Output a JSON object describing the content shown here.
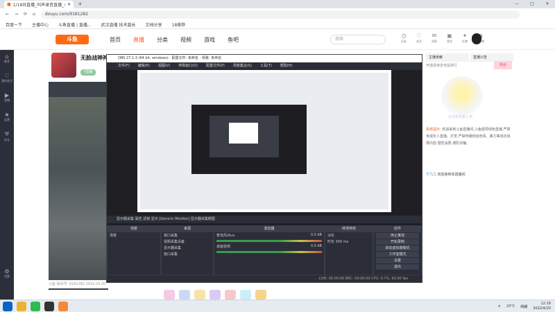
{
  "browser": {
    "tab_title": "1/18共直播_叫声录音直播_斗鱼",
    "close_glyph": "✕",
    "new_tab": "+",
    "url": "douyu.com/9181282",
    "bookmarks": [
      "百度一下",
      "主播中心",
      "斗鱼直播 | 直播,..",
      "武汉直播 技术越长",
      "文档分享",
      "18推荐"
    ]
  },
  "site": {
    "logo": "斗鱼",
    "nav": [
      {
        "label": "首页",
        "active": false
      },
      {
        "label": "直播",
        "active": true
      },
      {
        "label": "分类",
        "active": false
      },
      {
        "label": "视频",
        "active": false
      },
      {
        "label": "游戏",
        "active": false
      },
      {
        "label": "鱼吧",
        "active": false
      }
    ],
    "search_placeholder": "搜索",
    "header_icons": [
      {
        "icon": "history-icon",
        "label": "历史"
      },
      {
        "icon": "follow-icon",
        "label": "关注"
      },
      {
        "icon": "message-icon",
        "label": "消息"
      },
      {
        "icon": "bag-icon",
        "label": "背包"
      },
      {
        "icon": "gift-icon",
        "label": "礼物"
      },
      {
        "icon": "app-icon",
        "label": "客户端"
      }
    ]
  },
  "sidebar": [
    {
      "icon": "home-icon",
      "label": "推荐"
    },
    {
      "icon": "follow-icon",
      "label": "我的关注"
    },
    {
      "icon": "live-icon",
      "label": "直播"
    },
    {
      "icon": "recommend-icon",
      "label": "运营"
    },
    {
      "icon": "shield-icon",
      "label": "安全"
    },
    {
      "icon": "settings-icon",
      "label": "设置"
    }
  ],
  "room": {
    "title": "无脸战神神",
    "footer": "斗鱼 房间号: 9181282 2022.04.20",
    "live_tag": "Y直播"
  },
  "right_panel": {
    "tab1": "主播贡献",
    "tab2": "直播公告",
    "pink_label": "粉丝",
    "rank_note": "开通贵族享专属排行",
    "mascot_text": "还未有贡献上榜",
    "announce_title": "系统提示:",
    "announce_body": "欢迎来到斗鱼直播间,斗鱼倡导绿色直播,严禁未成年人直播、打赏,严禁传播低俗色情、暴力等违法违规内容,理性消费,谨防诈骗。",
    "chat_user": "宁几几",
    "chat_text": "欢迎来到本直播间"
  },
  "obs": {
    "title": "OBS 27.1.3 (64 bit, windows) - 配置文件: 未命名 - 场景: 未命名",
    "menus": [
      "文件(F)",
      "编辑(E)",
      "视图(V)",
      "停靠窗口(D)",
      "配置文件(P)",
      "场景集合(S)",
      "工具(T)",
      "帮助(H)"
    ],
    "ctrlbar": "显示器采集    属性    滤镜    显示    [Generic Monitor]    显示器采集截图",
    "docks": {
      "scenes_title": "场景",
      "scenes": [
        "场景"
      ],
      "sources_title": "来源",
      "sources": [
        "窗口采集",
        "视频采集设备",
        "显示器采集",
        "窗口采集"
      ],
      "mixer_title": "混音器",
      "mixer": [
        {
          "name": "麦克风/Aux",
          "db": "0.0 dB"
        },
        {
          "name": "桌面音频",
          "db": "0.0 dB"
        }
      ],
      "trans_title": "转场特效",
      "trans_type": "淡化",
      "trans_dur_label": "时长",
      "trans_dur": "300 ms",
      "ctrl_title": "控件",
      "controls": [
        "停止推流",
        "开始录制",
        "启动虚拟摄像机",
        "工作室模式",
        "设置",
        "退出"
      ]
    },
    "status": "LIVE: 00:00:00    REC: 00:00:00    CPU: 0.7%, 60.00 fps"
  },
  "taskbar": {
    "temperature": "23°C",
    "weather": "晴朗",
    "time": "12:18",
    "date": "2022/4/20"
  },
  "colors": {
    "accent": "#ff5d23",
    "sidebar": "#2b2f3a",
    "obs_bg": "#1f1f23"
  }
}
